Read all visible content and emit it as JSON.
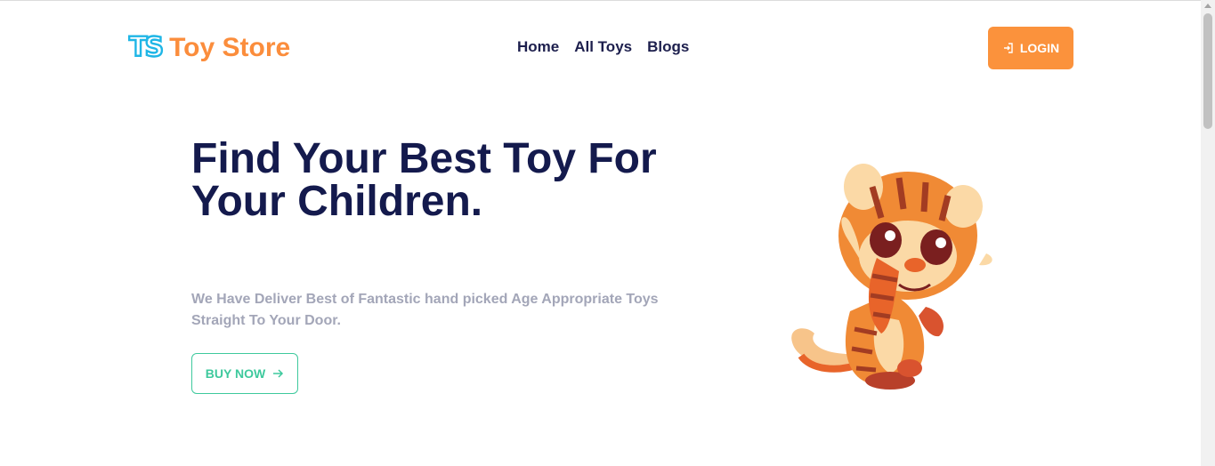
{
  "header": {
    "logo_mark": "TS",
    "logo_text": "Toy Store",
    "nav": [
      "Home",
      "All Toys",
      "Blogs"
    ],
    "login_label": "LOGIN",
    "login_icon": "login-icon"
  },
  "hero": {
    "title": "Find Your Best Toy For Your Children.",
    "subtitle": "We Have Deliver Best of Fantastic hand picked Age Appropriate Toys Straight To Your Door.",
    "cta_label": "BUY NOW",
    "cta_icon": "arrow-right-icon",
    "image": "tiger-toy-illustration"
  },
  "colors": {
    "brand_orange": "#fb8d3c",
    "logo_blue": "#1fb6e6",
    "heading_navy": "#141a4d",
    "cta_green": "#3ec99d",
    "subtitle_gray": "#a3a6b8"
  }
}
